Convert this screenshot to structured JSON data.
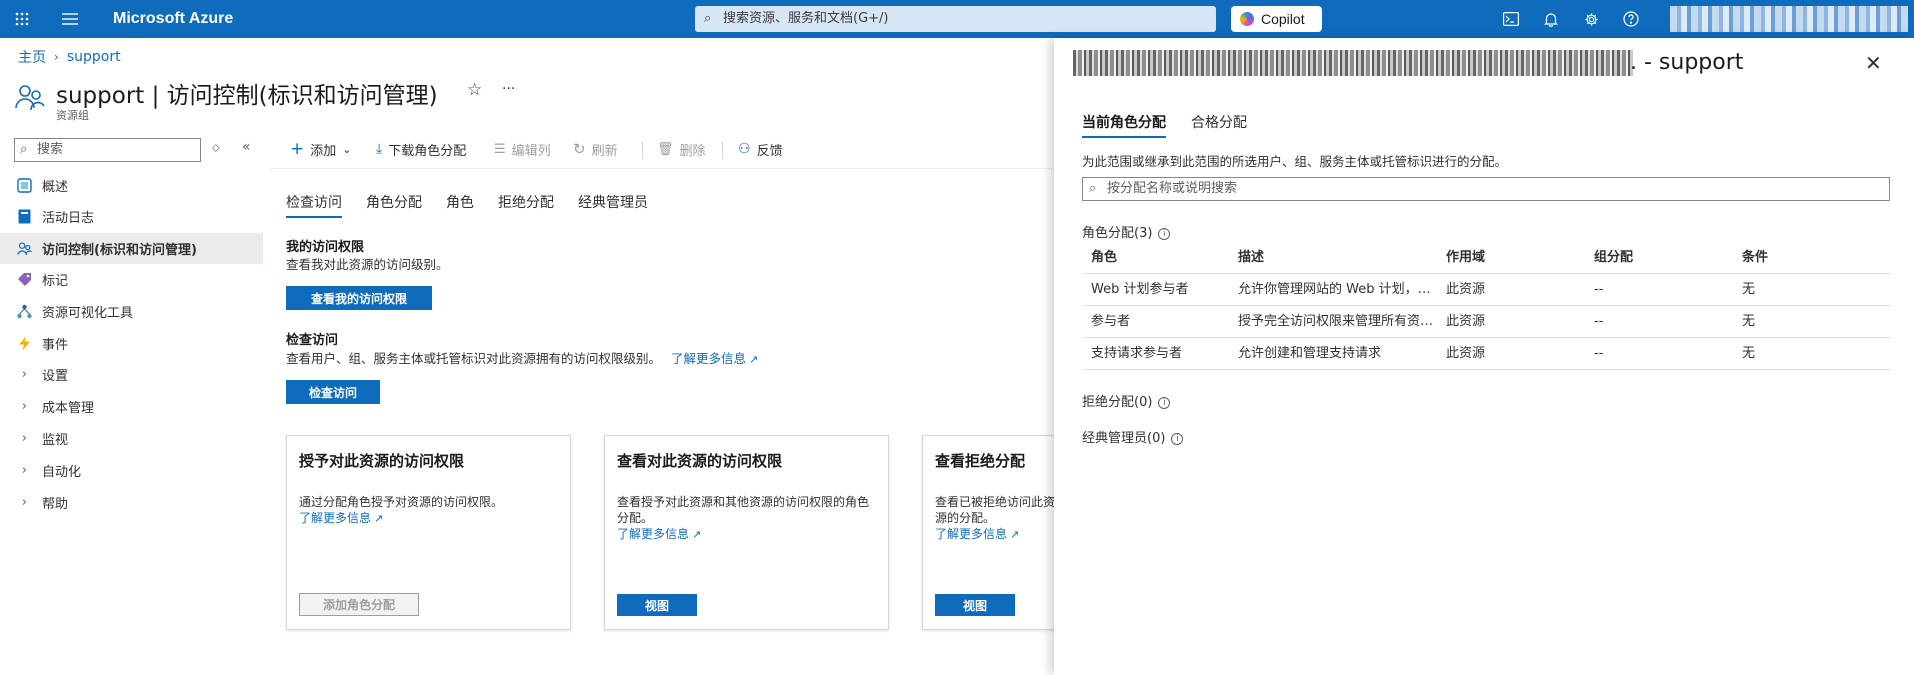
{
  "topbar": {
    "brand": "Microsoft Azure",
    "search_placeholder": "搜索资源、服务和文档(G+/)",
    "copilot_label": "Copilot",
    "icons": [
      "waffle-icon",
      "hamburger-icon",
      "cloud-shell-icon",
      "bell-icon",
      "gear-icon",
      "help-icon"
    ]
  },
  "breadcrumb": {
    "home": "主页",
    "current": "support"
  },
  "page": {
    "title": "support | 访问控制(标识和访问管理)",
    "subtitle": "资源组",
    "more": "···"
  },
  "sidebar": {
    "search_placeholder": "搜索",
    "items": [
      {
        "label": "概述",
        "icon": "overview-icon"
      },
      {
        "label": "活动日志",
        "icon": "activity-log-icon"
      },
      {
        "label": "访问控制(标识和访问管理)",
        "icon": "iam-icon",
        "selected": true
      },
      {
        "label": "标记",
        "icon": "tag-icon"
      },
      {
        "label": "资源可视化工具",
        "icon": "visualizer-icon"
      },
      {
        "label": "事件",
        "icon": "lightning-icon"
      },
      {
        "label": "设置",
        "icon": "chevron-right-icon"
      },
      {
        "label": "成本管理",
        "icon": "chevron-right-icon"
      },
      {
        "label": "监视",
        "icon": "chevron-right-icon"
      },
      {
        "label": "自动化",
        "icon": "chevron-right-icon"
      },
      {
        "label": "帮助",
        "icon": "chevron-right-icon"
      }
    ]
  },
  "toolbar": {
    "add": "添加",
    "download": "下载角色分配",
    "edit_columns": "编辑列",
    "refresh": "刷新",
    "delete": "删除",
    "feedback": "反馈"
  },
  "tabs": [
    "检查访问",
    "角色分配",
    "角色",
    "拒绝分配",
    "经典管理员"
  ],
  "my_access": {
    "heading": "我的访问权限",
    "desc": "查看我对此资源的访问级别。",
    "button": "查看我的访问权限"
  },
  "check_access": {
    "heading": "检查访问",
    "desc": "查看用户、组、服务主体或托管标识对此资源拥有的访问权限级别。",
    "link": "了解更多信息",
    "button": "检查访问"
  },
  "cards": [
    {
      "title": "授予对此资源的访问权限",
      "desc": "通过分配角色授予对资源的访问权限。",
      "link": "了解更多信息",
      "button": "添加角色分配"
    },
    {
      "title": "查看对此资源的访问权限",
      "desc": "查看授予对此资源和其他资源的访问权限的角色分配。",
      "link": "了解更多信息",
      "button": "视图"
    },
    {
      "title": "查看拒绝分配",
      "desc": "查看已被拒绝访问此资源的分配。",
      "link": "了解更多信息",
      "button": "视图"
    }
  ],
  "panel": {
    "title_suffix": ". - support",
    "tabs": [
      "当前角色分配",
      "合格分配"
    ],
    "description": "为此范围或继承到此范围的所选用户、组、服务主体或托管标识进行的分配。",
    "search_placeholder": "按分配名称或说明搜索",
    "role_assignments_heading": "角色分配(3)",
    "columns": [
      "角色",
      "描述",
      "作用域",
      "组分配",
      "条件"
    ],
    "rows": [
      {
        "role": "Web 计划参与者",
        "desc": "允许你管理网站的 Web 计划，…",
        "scope": "此资源",
        "group": "--",
        "condition": "无"
      },
      {
        "role": "参与者",
        "desc": "授予完全访问权限来管理所有资…",
        "scope": "此资源",
        "group": "--",
        "condition": "无"
      },
      {
        "role": "支持请求参与者",
        "desc": "允许创建和管理支持请求",
        "scope": "此资源",
        "group": "--",
        "condition": "无"
      }
    ],
    "deny_heading": "拒绝分配(0)",
    "classic_heading": "经典管理员(0)"
  },
  "colors": {
    "accent": "#0f6cbd",
    "topbar": "#0f6cbd",
    "selected_bg": "#edebe9"
  }
}
